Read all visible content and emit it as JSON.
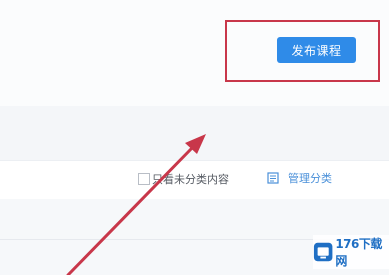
{
  "header": {
    "publish_button_label": "发布课程"
  },
  "filter_bar": {
    "only_uncategorized_label": "只看未分类内容",
    "only_uncategorized_checked": false,
    "manage_categories_label": "管理分类"
  },
  "annotation": {
    "highlight_color": "#c8374a",
    "arrow_color": "#c8374a"
  },
  "watermark": {
    "text": "176下载网"
  },
  "colors": {
    "accent": "#2f8be8",
    "link": "#4a90d9"
  }
}
